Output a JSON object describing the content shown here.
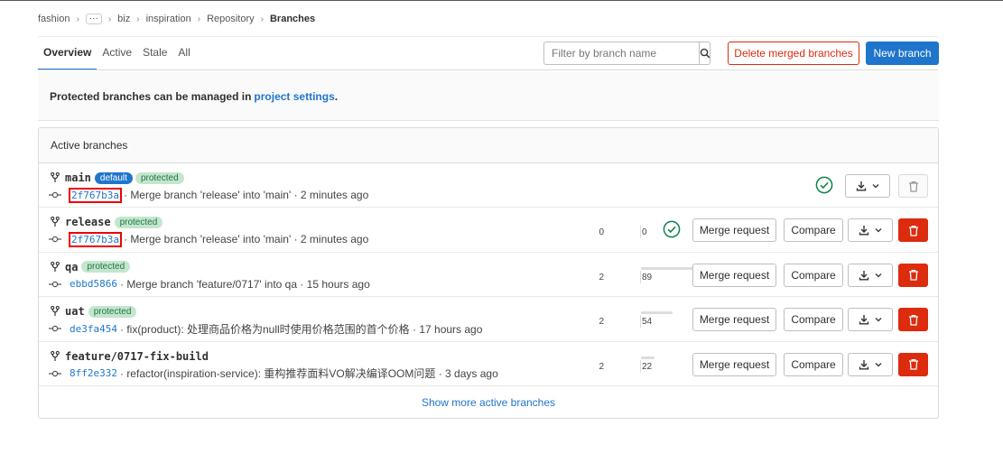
{
  "breadcrumb": {
    "items": [
      "fashion",
      "biz",
      "inspiration",
      "Repository"
    ],
    "current": "Branches",
    "more": "···"
  },
  "tabs": [
    "Overview",
    "Active",
    "Stale",
    "All"
  ],
  "filter": {
    "placeholder": "Filter by branch name",
    "value": ""
  },
  "buttons": {
    "delete_merged": "Delete merged branches",
    "new_branch": "New branch",
    "merge_request": "Merge request",
    "compare": "Compare"
  },
  "info": {
    "text": "Protected branches can be managed in",
    "link": "project settings",
    "period": "."
  },
  "section": {
    "title": "Active branches",
    "show_more": "Show more active branches"
  },
  "branches": [
    {
      "name": "main",
      "badges": [
        "default",
        "protected"
      ],
      "sha": "2f767b3a",
      "highlight": true,
      "message": "· Merge branch 'release' into 'main' · 2 minutes ago",
      "pipeline": "passed"
    },
    {
      "name": "release",
      "badges": [
        "protected"
      ],
      "sha": "2f767b3a",
      "highlight": true,
      "message": "· Merge branch 'release' into 'main' · 2 minutes ago",
      "behind": "0",
      "ahead": "0",
      "ahead_level": 0,
      "pipeline": "passed"
    },
    {
      "name": "qa",
      "badges": [
        "protected"
      ],
      "sha": "ebbd5866",
      "message": "· Merge branch 'feature/0717' into qa · 15 hours ago",
      "behind": "2",
      "ahead": "89",
      "ahead_level": 1.0
    },
    {
      "name": "uat",
      "badges": [
        "protected"
      ],
      "sha": "de3fa454",
      "message": "· fix(product): 处理商品价格为null时使用价格范围的首个价格 · 17 hours ago",
      "behind": "2",
      "ahead": "54",
      "ahead_level": 0.61
    },
    {
      "name": "feature/0717-fix-build",
      "badges": [],
      "sha": "8ff2e332",
      "message": "· refactor(inspiration-service): 重构推荐面料VO解决编译OOM问题 · 3 days ago",
      "behind": "2",
      "ahead": "22",
      "ahead_level": 0.25
    }
  ],
  "colors": {
    "accent": "#1f75cb",
    "danger": "#dd2b0e",
    "success": "#108548",
    "highlight": "#e00000"
  }
}
